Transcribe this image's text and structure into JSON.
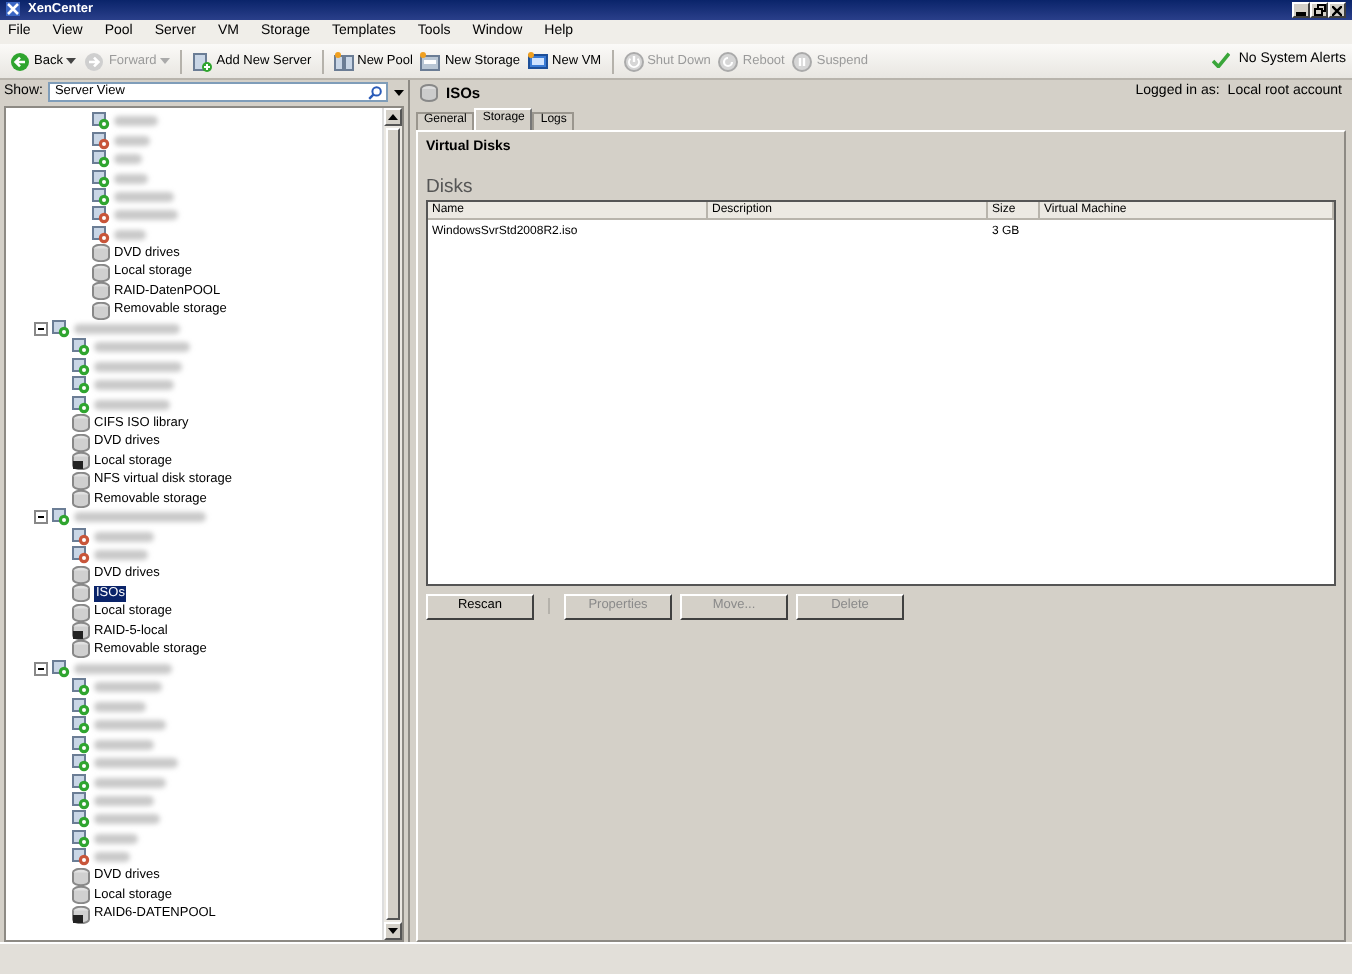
{
  "window": {
    "title": "XenCenter"
  },
  "menu": [
    "File",
    "View",
    "Pool",
    "Server",
    "VM",
    "Storage",
    "Templates",
    "Tools",
    "Window",
    "Help"
  ],
  "toolbar": [
    [
      {
        "label": "Back",
        "kind": "back",
        "disabled": false,
        "dropdown": true
      },
      {
        "label": "Forward",
        "kind": "forward",
        "disabled": true,
        "dropdown": true
      }
    ],
    [
      {
        "label": "Add New Server",
        "kind": "add_server",
        "disabled": false,
        "dropdown": false
      }
    ],
    [
      {
        "label": "New Pool",
        "kind": "pool",
        "disabled": false,
        "dropdown": false
      },
      {
        "label": "New Storage",
        "kind": "storage",
        "disabled": false,
        "dropdown": false
      },
      {
        "label": "New VM",
        "kind": "vm",
        "disabled": false,
        "dropdown": false
      }
    ],
    [
      {
        "label": "Shut Down",
        "kind": "shutdown",
        "disabled": true,
        "dropdown": false
      },
      {
        "label": "Reboot",
        "kind": "reboot",
        "disabled": true,
        "dropdown": false
      },
      {
        "label": "Suspend",
        "kind": "suspend",
        "disabled": true,
        "dropdown": false
      }
    ]
  ],
  "alerts": {
    "label": "No System Alerts"
  },
  "sidebar": {
    "show_label": "Show:",
    "view": "Server View",
    "tree": [
      {
        "kind": "offscreen",
        "children": [
          {
            "kind": "vm",
            "running": true,
            "selected": false
          },
          {
            "kind": "vm",
            "running": false,
            "selected": false
          },
          {
            "kind": "vm",
            "running": true,
            "selected": false
          },
          {
            "kind": "vm",
            "running": true,
            "selected": false
          },
          {
            "kind": "vm",
            "running": true,
            "selected": false
          },
          {
            "kind": "vm",
            "running": false,
            "selected": false
          },
          {
            "kind": "vm",
            "running": false,
            "selected": false
          },
          {
            "kind": "storage",
            "label": "DVD drives",
            "selected": false
          },
          {
            "kind": "storage",
            "label": "Local storage",
            "selected": false
          },
          {
            "kind": "storage",
            "label": "RAID-DatenPOOL",
            "selected": false
          },
          {
            "kind": "storage",
            "label": "Removable storage",
            "selected": false
          }
        ]
      },
      {
        "kind": "host",
        "expanded": true,
        "selected": false,
        "children": [
          {
            "kind": "vm",
            "running": true,
            "selected": false
          },
          {
            "kind": "vm",
            "running": true,
            "selected": false
          },
          {
            "kind": "vm",
            "running": true,
            "selected": false
          },
          {
            "kind": "vm",
            "running": true,
            "selected": false
          },
          {
            "kind": "storage",
            "label": "CIFS ISO library",
            "selected": false
          },
          {
            "kind": "storage",
            "label": "DVD drives",
            "selected": false
          },
          {
            "kind": "local_storage",
            "label": "Local storage",
            "selected": false
          },
          {
            "kind": "storage",
            "label": "NFS virtual disk storage",
            "selected": false
          },
          {
            "kind": "storage",
            "label": "Removable storage",
            "selected": false
          }
        ]
      },
      {
        "kind": "host",
        "expanded": true,
        "selected": false,
        "children": [
          {
            "kind": "vm",
            "running": false,
            "selected": false
          },
          {
            "kind": "vm",
            "running": false,
            "selected": false
          },
          {
            "kind": "storage",
            "label": "DVD drives",
            "selected": false
          },
          {
            "kind": "storage",
            "label": "ISOs",
            "selected": true
          },
          {
            "kind": "storage",
            "label": "Local storage",
            "selected": false
          },
          {
            "kind": "local_storage",
            "label": "RAID-5-local",
            "selected": false
          },
          {
            "kind": "storage",
            "label": "Removable storage",
            "selected": false
          }
        ]
      },
      {
        "kind": "host",
        "expanded": true,
        "selected": false,
        "children": [
          {
            "kind": "vm",
            "running": true,
            "selected": false
          },
          {
            "kind": "vm",
            "running": true,
            "selected": false
          },
          {
            "kind": "vm",
            "running": true,
            "selected": false
          },
          {
            "kind": "vm",
            "running": true,
            "selected": false
          },
          {
            "kind": "vm",
            "running": true,
            "selected": false
          },
          {
            "kind": "vm",
            "running": true,
            "selected": false
          },
          {
            "kind": "vm",
            "running": true,
            "selected": false
          },
          {
            "kind": "vm",
            "running": true,
            "selected": false
          },
          {
            "kind": "vm",
            "running": true,
            "selected": false
          },
          {
            "kind": "vm",
            "running": false,
            "selected": false
          },
          {
            "kind": "storage",
            "label": "DVD drives",
            "selected": false
          },
          {
            "kind": "storage",
            "label": "Local storage",
            "selected": false
          },
          {
            "kind": "local_storage",
            "label": "RAID6-DATENPOOL",
            "selected": false
          }
        ]
      }
    ]
  },
  "header": {
    "title": "ISOs",
    "logged_in_label": "Logged in as:",
    "account": "Local root account"
  },
  "tabs": [
    {
      "label": "General",
      "selected": false
    },
    {
      "label": "Storage",
      "selected": true
    },
    {
      "label": "Logs",
      "selected": false
    }
  ],
  "section_title": "Virtual Disks",
  "disks_heading": "Disks",
  "table": {
    "columns": [
      "Name",
      "Description",
      "Size",
      "Virtual Machine"
    ],
    "rows": [
      {
        "name": "WindowsSvrStd2008R2.iso",
        "size": "3 GB"
      }
    ]
  },
  "buttons": [
    {
      "label": "Rescan",
      "disabled": false
    },
    {
      "label": "Properties",
      "disabled": true
    },
    {
      "label": "Move...",
      "disabled": true
    },
    {
      "label": "Delete",
      "disabled": true
    }
  ]
}
